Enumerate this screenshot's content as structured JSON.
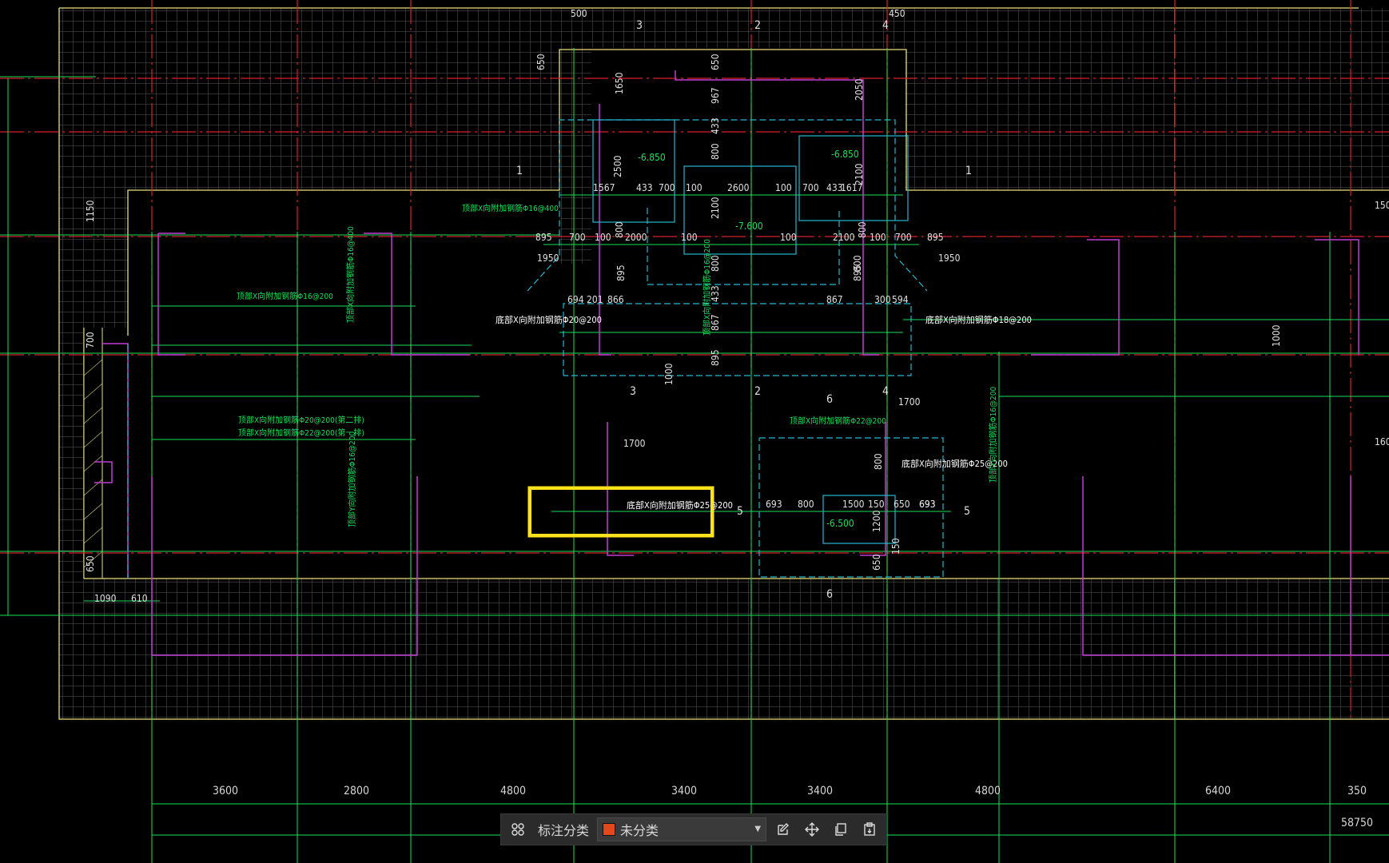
{
  "colors": {
    "background": "#000000",
    "grid": "#5a5a5a",
    "axis_red": "#d8202a",
    "green": "#19e05a",
    "yellow": "#e8e07a",
    "magenta": "#c23cd6",
    "cyan": "#25b6cf",
    "highlight": "#ffe21a",
    "swatch": "#e2481b"
  },
  "top_dims": [
    "500",
    "450",
    "650",
    "650",
    "1650",
    "967",
    "433",
    "800",
    "2050",
    "2500",
    "2100",
    "2100"
  ],
  "section_marks": [
    "3",
    "2",
    "4",
    "1",
    "1",
    "3",
    "2",
    "4",
    "5",
    "5",
    "6",
    "6"
  ],
  "elevations": [
    "-6.850",
    "-6.850",
    "-7.600",
    "-6.500"
  ],
  "row1_dims": [
    "1567",
    "433",
    "700",
    "100",
    "2600",
    "100",
    "700",
    "433",
    "1617"
  ],
  "row2_dims": [
    "895",
    "700",
    "100",
    "800",
    "2000",
    "100",
    "100",
    "2100",
    "800",
    "100",
    "700",
    "895"
  ],
  "mid_dims": [
    "1950",
    "1950",
    "895",
    "800",
    "895",
    "433",
    "867",
    "800",
    "895"
  ],
  "row3_dims": [
    "694",
    "201",
    "866",
    "867",
    "300",
    "594"
  ],
  "left_dims": [
    "1150",
    "700",
    "650",
    "1090",
    "610"
  ],
  "right_dims": [
    "1000",
    "150",
    "160"
  ],
  "center_dims": [
    "1000",
    "1700",
    "1700"
  ],
  "lower_dims": [
    "693",
    "800",
    "693",
    "800",
    "1500",
    "150",
    "650",
    "693",
    "1200",
    "650",
    "150"
  ],
  "rebar_notes": [
    "顶部X向附加钢筋Φ16@400",
    "顶部X向附加钢筋Φ16@200",
    "顶部X向附加钢筋Φ16@400",
    "底部X向附加钢筋Φ20@200",
    "底部X向附加钢筋Φ18@200",
    "顶部X向附加钢筋Φ20@200(第二排)",
    "顶部X向附加钢筋Φ22@200(第一排)",
    "顶部Y向附加钢筋Φ16@200",
    "顶部X向附加钢筋Φ22@200",
    "底部X向附加钢筋Φ25@200",
    "底部X向附加钢筋Φ25@200",
    "顶部X向附加钢筋Φ16@200",
    "顶部Y向附加钢筋Φ16@200"
  ],
  "bottom_dims": [
    "3600",
    "2800",
    "4800",
    "3400",
    "3400",
    "4800",
    "6400",
    "350"
  ],
  "total_dim": "58750",
  "toolbar": {
    "classify_label": "标注分类",
    "selected_category": "未分类",
    "icons": [
      "grid-icon",
      "edit-icon",
      "move-icon",
      "copy-icon",
      "paste-icon"
    ]
  }
}
